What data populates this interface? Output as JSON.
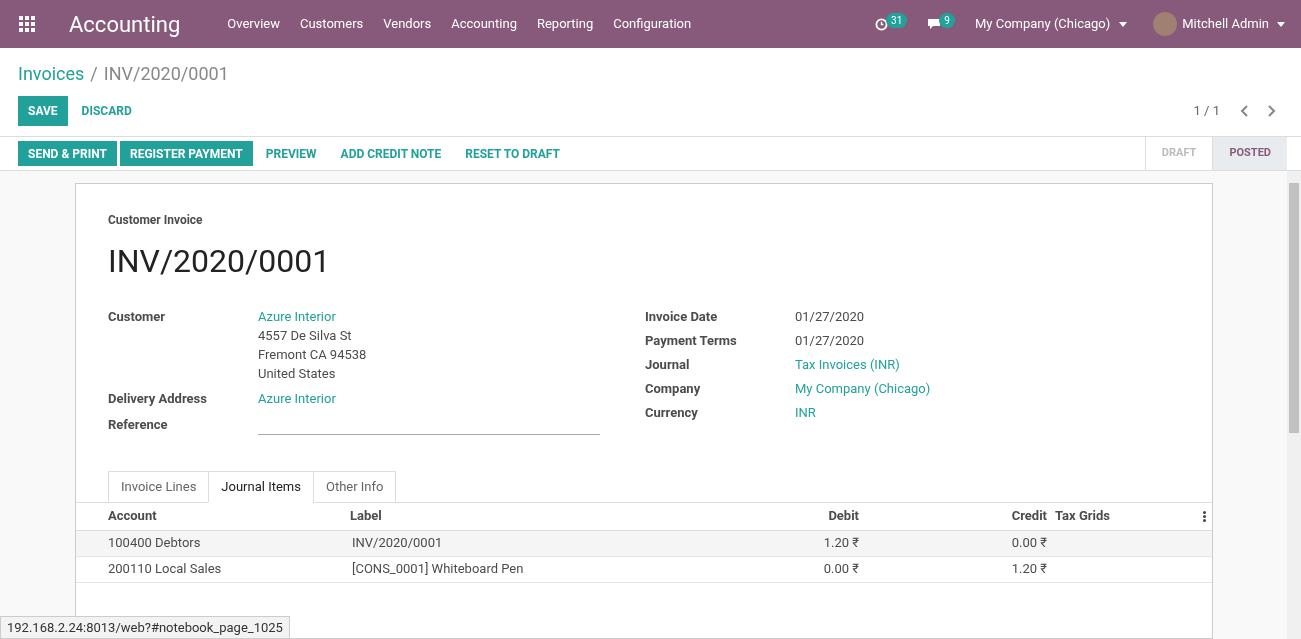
{
  "navbar": {
    "app_title": "Accounting",
    "menu": [
      "Overview",
      "Customers",
      "Vendors",
      "Accounting",
      "Reporting",
      "Configuration"
    ],
    "activity_count": "31",
    "message_count": "9",
    "company": "My Company (Chicago)",
    "user": "Mitchell Admin"
  },
  "breadcrumb": {
    "parent": "Invoices",
    "separator": "/",
    "current": "INV/2020/0001"
  },
  "control_buttons": [
    {
      "label": "SAVE",
      "kind": "primary"
    },
    {
      "label": "DISCARD",
      "kind": "link"
    }
  ],
  "pager": "1 / 1",
  "action_buttons": [
    {
      "label": "SEND & PRINT",
      "kind": "primary"
    },
    {
      "label": "REGISTER PAYMENT",
      "kind": "primary"
    },
    {
      "label": "PREVIEW",
      "kind": "link"
    },
    {
      "label": "ADD CREDIT NOTE",
      "kind": "link"
    },
    {
      "label": "RESET TO DRAFT",
      "kind": "link"
    }
  ],
  "status_steps": [
    {
      "label": "DRAFT",
      "selected": false
    },
    {
      "label": "POSTED",
      "selected": true
    }
  ],
  "form": {
    "subtitle": "Customer Invoice",
    "title": "INV/2020/0001",
    "left_fields": [
      {
        "label": "Customer",
        "value": "Azure Interior",
        "address": [
          "4557 De Silva St",
          "Fremont CA 94538",
          "United States"
        ]
      },
      {
        "label": "Delivery Address",
        "value": "Azure Interior"
      },
      {
        "label": "Reference"
      }
    ],
    "right_fields": [
      {
        "label": "Invoice Date",
        "value": "01/27/2020",
        "link": false
      },
      {
        "label": "Payment Terms",
        "value": "01/27/2020",
        "link": false
      },
      {
        "label": "Journal",
        "value": "Tax Invoices (INR)",
        "link": true
      },
      {
        "label": "Company",
        "value": "My Company (Chicago)",
        "link": true
      },
      {
        "label": "Currency",
        "value": "INR",
        "link": true
      }
    ]
  },
  "tabs": [
    {
      "label": "Invoice Lines",
      "selected": false
    },
    {
      "label": "Journal Items",
      "selected": true
    },
    {
      "label": "Other Info",
      "selected": false
    }
  ],
  "table": {
    "columns": [
      "Account",
      "Label",
      "Debit",
      "Credit",
      "Tax Grids"
    ],
    "rows": [
      [
        "100400 Debtors",
        "INV/2020/0001",
        "1.20 ₹",
        "0.00 ₹",
        ""
      ],
      [
        "200110 Local Sales",
        "[CONS_0001] Whiteboard Pen",
        "0.00 ₹",
        "1.20 ₹",
        ""
      ]
    ]
  },
  "status_bar": "192.168.2.24:8013/web?#notebook_page_1025"
}
